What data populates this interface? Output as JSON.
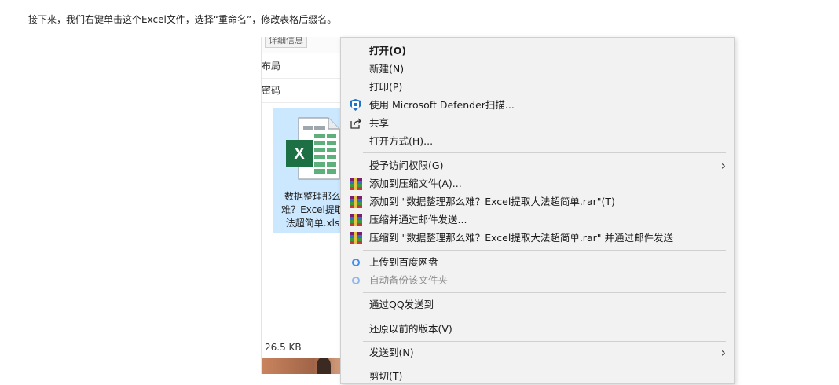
{
  "instruction": "接下来，我们右键单击这个Excel文件，选择“重命名”，修改表格后缀名。",
  "explorer": {
    "top_chip": "详细信息",
    "rows": [
      "布局",
      "密码"
    ],
    "file_name_lines": [
      "数据整理那么",
      "难？Excel提取",
      "法超简单.xls"
    ],
    "file_size": "26.5 KB"
  },
  "context_menu": {
    "items": [
      {
        "label": "打开(O)"
      },
      {
        "label": "新建(N)"
      },
      {
        "label": "打印(P)"
      },
      {
        "label": "使用 Microsoft Defender扫描...",
        "icon": "shield-icon"
      },
      {
        "label": "共享",
        "icon": "share-icon"
      },
      {
        "label": "打开方式(H)..."
      },
      {
        "label": "授予访问权限(G)",
        "submenu": true
      },
      {
        "label": "添加到压缩文件(A)...",
        "icon": "winrar-icon"
      },
      {
        "label": "添加到 \"数据整理那么难？Excel提取大法超简单.rar\"(T)",
        "icon": "winrar-icon"
      },
      {
        "label": "压缩并通过邮件发送...",
        "icon": "winrar-icon"
      },
      {
        "label": "压缩到 \"数据整理那么难？Excel提取大法超简单.rar\" 并通过邮件发送",
        "icon": "winrar-icon"
      },
      {
        "label": "上传到百度网盘",
        "icon": "baidu-cloud-icon"
      },
      {
        "label": "自动备份该文件夹",
        "icon": "baidu-cloud-icon",
        "disabled": true
      },
      {
        "label": "通过QQ发送到"
      },
      {
        "label": "还原以前的版本(V)"
      },
      {
        "label": "发送到(N)",
        "submenu": true
      },
      {
        "label": "剪切(T)"
      }
    ],
    "submenu_arrow": "›"
  },
  "colors": {
    "menu_bg": "#f2f2f2",
    "selection_bg": "#cce8ff",
    "excel_green": "#1d7044",
    "shield_blue": "#1e73c8"
  }
}
